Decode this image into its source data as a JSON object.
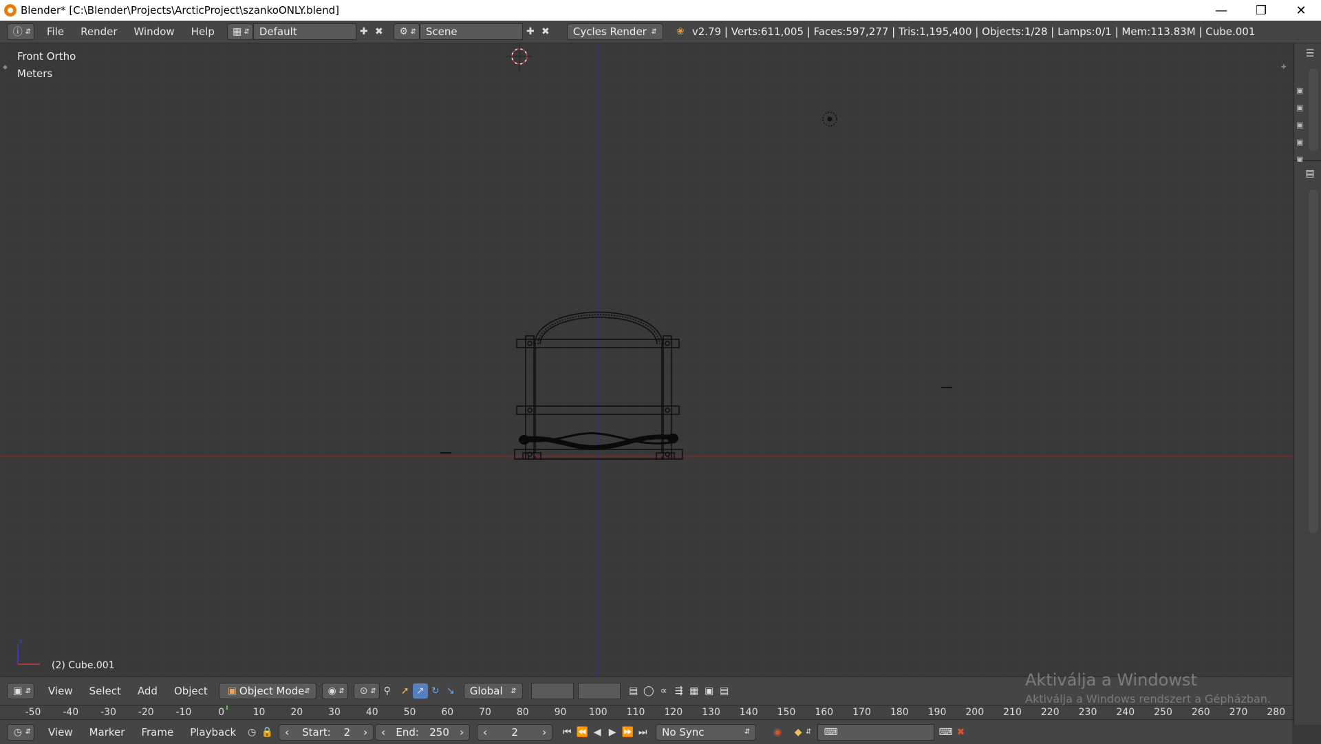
{
  "window": {
    "title": "Blender* [C:\\Blender\\Projects\\ArcticProject\\szankoONLY.blend]",
    "controls": [
      "minimize-icon",
      "maximize-icon",
      "close-icon"
    ]
  },
  "info_header": {
    "menus": [
      "File",
      "Render",
      "Window",
      "Help"
    ],
    "layout": "Default",
    "scene": "Scene",
    "engine": "Cycles Render",
    "stats": "v2.79 | Verts:611,005 | Faces:597,277 | Tris:1,195,400 | Objects:1/28 | Lamps:0/1 | Mem:113.83M | Cube.001"
  },
  "viewport": {
    "view_name": "Front Ortho",
    "units": "Meters",
    "active_object": "(2) Cube.001",
    "colors": {
      "background": "#393939",
      "x_axis": "#8a2a2a",
      "z_axis": "#2f2f8f",
      "wire": "#111111"
    }
  },
  "view3d_header": {
    "menus": [
      "View",
      "Select",
      "Add",
      "Object"
    ],
    "mode": "Object Mode",
    "orientation": "Global"
  },
  "timeline": {
    "ruler": [
      "-50",
      "-40",
      "-30",
      "-20",
      "-10",
      "0",
      "10",
      "20",
      "30",
      "40",
      "50",
      "60",
      "70",
      "80",
      "90",
      "100",
      "110",
      "120",
      "130",
      "140",
      "150",
      "160",
      "170",
      "180",
      "190",
      "200",
      "210",
      "220",
      "230",
      "240",
      "250",
      "260",
      "270",
      "280"
    ],
    "menus": [
      "View",
      "Marker",
      "Frame",
      "Playback"
    ],
    "start_label": "Start:",
    "start_value": "2",
    "end_label": "End:",
    "end_value": "250",
    "current_frame": "2",
    "sync": "No Sync"
  },
  "watermark": {
    "line1": "Aktiválja a Windowst",
    "line2": "Aktiválja a Windows rendszert a Gépházban."
  }
}
